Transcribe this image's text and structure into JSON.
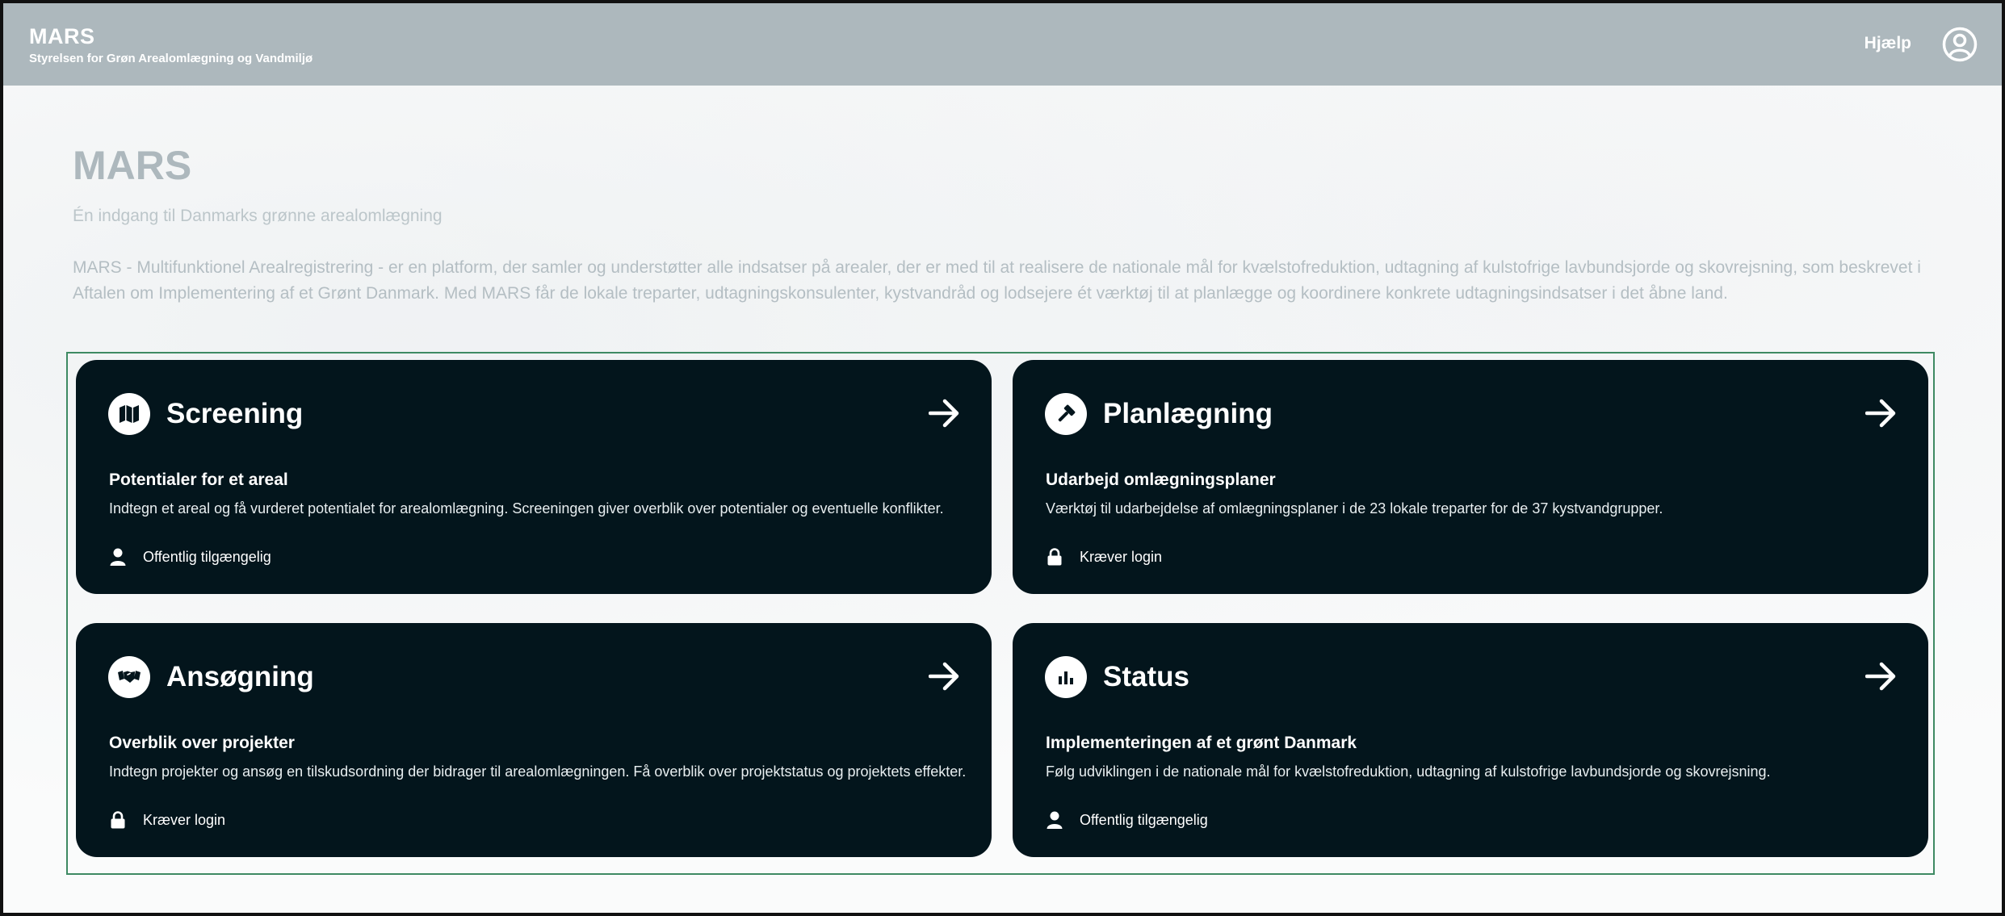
{
  "header": {
    "brand_name": "MARS",
    "org_name": "Styrelsen for Grøn Arealomlægning og Vandmiljø",
    "help_label": "Hjælp",
    "user_icon": "user-circle-icon"
  },
  "hero": {
    "title": "MARS",
    "subtitle": "Én indgang til Danmarks grønne arealomlægning",
    "description": "MARS - Multifunktionel Arealregistrering - er en platform, der samler og understøtter alle indsatser på arealer, der er med til at realisere de nationale mål for kvælstofreduktion, udtagning af kulstofrige lavbundsjorde og skovrejsning, som beskrevet i Aftalen om Implementering af et Grønt Danmark. Med MARS får de lokale treparter, udtagningskonsulenter, kystvandråd og lodsejere ét værktøj til at planlægge og koordinere konkrete udtagningsindsatser i det åbne land."
  },
  "colors": {
    "header_bg": "#adb8bd",
    "card_bg": "#03151c",
    "cards_border": "#3e8a63"
  },
  "cards": [
    {
      "title": "Screening",
      "icon": "map-icon",
      "heading": "Potentialer for et areal",
      "text": "Indtegn et areal og få vurderet potentialet for arealomlægning. Screeningen giver overblik over potentialer og eventuelle konflikter.",
      "access_icon": "person-icon",
      "access": "Offentlig tilgængelig"
    },
    {
      "title": "Planlægning",
      "icon": "hammer-icon",
      "heading": "Udarbejd omlægningsplaner",
      "text": "Værktøj til udarbejdelse af omlægningsplaner i de 23 lokale treparter for de 37 kystvandgrupper.",
      "access_icon": "lock-icon",
      "access": "Kræver login"
    },
    {
      "title": "Ansøgning",
      "icon": "handshake-icon",
      "heading": "Overblik over projekter",
      "text": "Indtegn projekter og ansøg en tilskudsordning der bidrager til arealomlægningen. Få overblik over projektstatus og projektets effekter.",
      "access_icon": "lock-icon",
      "access": "Kræver login"
    },
    {
      "title": "Status",
      "icon": "bar-chart-icon",
      "heading": "Implementeringen af et grønt Danmark",
      "text": "Følg udviklingen i de nationale mål for kvælstofreduktion, udtagning af kulstofrige lavbundsjorde og skovrejsning.",
      "access_icon": "person-icon",
      "access": "Offentlig tilgængelig"
    }
  ]
}
